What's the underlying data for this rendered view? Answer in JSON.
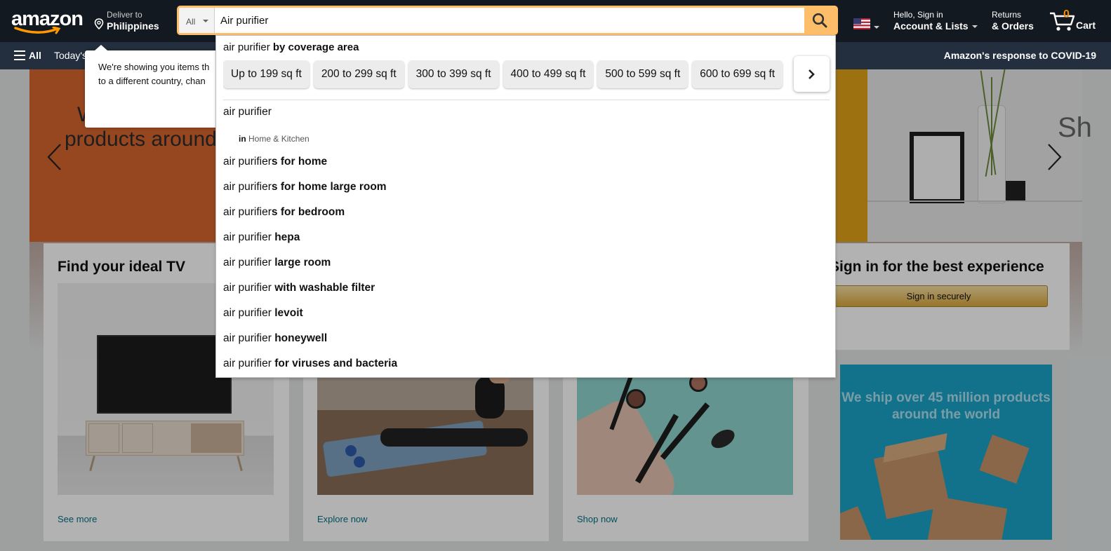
{
  "header": {
    "logo_text": "amazon",
    "deliver_line1": "Deliver to",
    "deliver_line2": "Philippines",
    "search_category": "All",
    "search_value": "Air purifier",
    "account_line1": "Hello, Sign in",
    "account_line2": "Account & Lists",
    "returns_line1": "Returns",
    "returns_line2": "& Orders",
    "cart_count": "0",
    "cart_label": "Cart"
  },
  "subnav": {
    "all_label": "All",
    "todays_label": "Today's",
    "covid_label": "Amazon's response to COVID-19"
  },
  "location_popover": {
    "text_line1": "We're showing you items th",
    "text_line2": "to a different country, chan"
  },
  "hero": {
    "text_line1": "W",
    "text_line2": "products around",
    "right_partial": "Sh"
  },
  "autocomplete": {
    "header_prefix": "air purifier",
    "header_bold": "by coverage area",
    "chips": [
      "Up to 199 sq ft",
      "200 to 299 sq ft",
      "300 to 399 sq ft",
      "400 to 499 sq ft",
      "500 to 599 sq ft",
      "600 to 699 sq ft"
    ],
    "dept_prefix": "in",
    "dept_name": "Home & Kitchen",
    "suggestions": [
      {
        "plain": "air purifier",
        "bold": ""
      },
      {
        "plain": "air purifier",
        "bold": "s for home"
      },
      {
        "plain": "air purifier",
        "bold": "s for home large room"
      },
      {
        "plain": "air purifier",
        "bold": "s for bedroom"
      },
      {
        "plain": "air purifier ",
        "bold": "hepa"
      },
      {
        "plain": "air purifier ",
        "bold": "large room"
      },
      {
        "plain": "air purifier ",
        "bold": "with washable filter"
      },
      {
        "plain": "air purifier ",
        "bold": "levoit"
      },
      {
        "plain": "air purifier ",
        "bold": "honeywell"
      },
      {
        "plain": "air purifier ",
        "bold": "for viruses and bacteria"
      }
    ]
  },
  "cards": {
    "tv_title": "Find your ideal TV",
    "tv_link": "See more",
    "fitness_link": "Explore now",
    "beauty_link": "Shop now",
    "signin_title": "Sign in for the best experience",
    "signin_button": "Sign in securely",
    "ship_text": "We ship over 45 million products around the world"
  },
  "colors": {
    "nav_dark": "#131921",
    "nav_sub": "#232f3e",
    "search_accent": "#febd69",
    "link": "#007185",
    "cart_count": "#f08804"
  }
}
